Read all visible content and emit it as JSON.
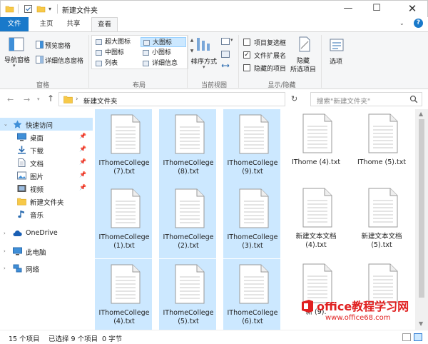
{
  "window": {
    "title": "新建文件夹",
    "minimize": "—",
    "maximize": "☐",
    "close": "✕"
  },
  "tabs": [
    {
      "label": "文件"
    },
    {
      "label": "主页"
    },
    {
      "label": "共享"
    },
    {
      "label": "查看"
    }
  ],
  "ribbon": {
    "panes": {
      "nav_pane": "导航窗格",
      "preview_pane": "预览窗格",
      "details_pane": "详细信息窗格",
      "label": "窗格"
    },
    "layout": {
      "items": [
        "超大图标",
        "大图标",
        "中图标",
        "小图标",
        "列表",
        "详细信息"
      ],
      "selected": "大图标",
      "label": "布局"
    },
    "current_view": {
      "sort_by": "排序方式",
      "label": "当前视图"
    },
    "show_hide": {
      "item_checkboxes": "项目复选框",
      "file_extensions": "文件扩展名",
      "hidden_items": "隐藏的项目",
      "hide_selected_1": "隐藏",
      "hide_selected_2": "所选项目",
      "label": "显示/隐藏",
      "checks": {
        "item_checkboxes": false,
        "file_extensions": true,
        "hidden_items": false
      }
    },
    "options": {
      "label": "选项"
    }
  },
  "address": {
    "path": "新建文件夹",
    "separator": "›",
    "search_placeholder": "搜索\"新建文件夹\""
  },
  "navpane": {
    "items": [
      {
        "label": "快速访问",
        "pinned": false
      },
      {
        "label": "桌面",
        "pinned": true
      },
      {
        "label": "下载",
        "pinned": true
      },
      {
        "label": "文档",
        "pinned": true
      },
      {
        "label": "图片",
        "pinned": true
      },
      {
        "label": "视频",
        "pinned": true
      },
      {
        "label": "新建文件夹",
        "pinned": false
      },
      {
        "label": "音乐",
        "pinned": false
      },
      {
        "label": "OneDrive",
        "pinned": false
      },
      {
        "label": "此电脑",
        "pinned": false
      },
      {
        "label": "网络",
        "pinned": false
      }
    ],
    "pin_glyph": "📌"
  },
  "files": [
    {
      "name": "IThomeCollege (7).txt",
      "selected": true
    },
    {
      "name": "IThomeCollege (8).txt",
      "selected": true
    },
    {
      "name": "IThomeCollege (9).txt",
      "selected": true
    },
    {
      "name": "IThome (4).txt",
      "selected": false
    },
    {
      "name": "IThome (5).txt",
      "selected": false
    },
    {
      "name": "IThomeCollege (1).txt",
      "selected": true
    },
    {
      "name": "IThomeCollege (2).txt",
      "selected": true
    },
    {
      "name": "IThomeCollege (3).txt",
      "selected": true
    },
    {
      "name": "新建文本文档 (4).txt",
      "selected": false
    },
    {
      "name": "新建文本文档 (5).txt",
      "selected": false
    },
    {
      "name": "IThomeCollege (4).txt",
      "selected": true
    },
    {
      "name": "IThomeCollege (5).txt",
      "selected": true
    },
    {
      "name": "IThomeCollege (6).txt",
      "selected": true
    },
    {
      "name": "新 (9).",
      "selected": false
    },
    {
      "name": "",
      "selected": false
    }
  ],
  "status": {
    "count": "15 个项目",
    "selected": "已选择 9 个项目",
    "size": "0 字节"
  },
  "watermark": {
    "title": "office教程学习网",
    "url": "www.office68.com"
  },
  "colors": {
    "accent": "#1979ca",
    "selection": "#cce8ff"
  }
}
